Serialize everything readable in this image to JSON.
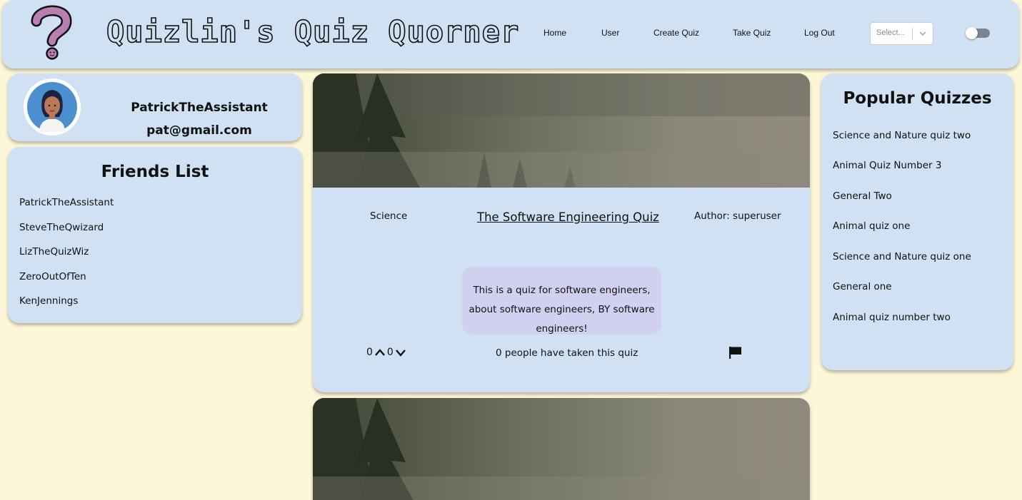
{
  "header": {
    "site_title": "Quizlin's Quiz Quorner",
    "logo_icon": "question-mark-logo-icon",
    "nav": [
      "Home",
      "User",
      "Create Quiz",
      "Take Quiz",
      "Log Out"
    ],
    "select_placeholder": "Select...",
    "theme_toggle": "off"
  },
  "profile": {
    "username": "PatrickTheAssistant",
    "email": "pat@gmail.com",
    "avatar_icon": "user-avatar-icon"
  },
  "friends": {
    "title": "Friends List",
    "items": [
      "PatrickTheAssistant",
      "SteveTheQwizard",
      "LizTheQuizWiz",
      "ZeroOutOfTen",
      "KenJennings"
    ]
  },
  "popular": {
    "title": "Popular Quizzes",
    "items": [
      "Science and Nature quiz two",
      "Animal Quiz Number 3",
      "General Two",
      "Animal quiz one",
      "Science and Nature quiz one",
      "General one",
      "Animal quiz number two"
    ]
  },
  "quizzes": [
    {
      "category": "Science",
      "title": "The Software Engineering Quiz",
      "author": "Author: superuser",
      "description": "This is a quiz for software engineers, about software engineers, BY software engineers!",
      "upvotes": "0",
      "downvotes": "0",
      "taken": "0 people have taken this quiz"
    }
  ],
  "colors": {
    "background": "#fdf7d8",
    "panel": "#cfe1f3",
    "description_bg": "#d2d0f0",
    "logo": "#b97fb0"
  }
}
